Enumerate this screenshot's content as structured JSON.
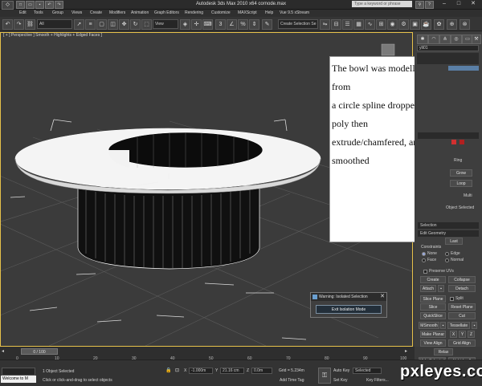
{
  "window": {
    "title": "Autodesk 3ds Max 2010 x64      cornode.max",
    "search_placeholder": "Type a keyword or phrase",
    "app_icon": "3ds-max-icon"
  },
  "menu": [
    "Edit",
    "Tools",
    "Group",
    "Views",
    "Create",
    "Modifiers",
    "Animation",
    "Graph Editors",
    "Rendering",
    "Customize",
    "MAXScript",
    "Help",
    "Vue 9.5 xStream"
  ],
  "toolbar": {
    "selection_filter": "All",
    "reference_coord": "View",
    "named_selection": "Create Selection Se"
  },
  "viewport": {
    "label": "[ + ] Perspective ] Smooth + Highlights + Edged Faces ]"
  },
  "command_panel": {
    "object_name": "ylt01",
    "rollouts": [
      "Selection",
      "Edit Geometry"
    ],
    "labels": {
      "ring": "Ring",
      "loop": "Loop",
      "grow": "Grow",
      "object_selected": "Object Selected",
      "last": "Last",
      "constraints": "Constraints",
      "none": "None",
      "edge": "Edge",
      "face": "Face",
      "normal": "Normal",
      "preserve_uvs": "Preserve UVs",
      "create": "Create",
      "collapse": "Collapse",
      "attach": "Attach",
      "detach": "Detach",
      "slice_plane": "Slice Plane",
      "split": "Split",
      "slice": "Slice",
      "reset_plane": "Reset Plane",
      "quickslice": "QuickSlice",
      "cut": "Cut",
      "msmooth": "MSmooth",
      "tessellate": "Tessellate",
      "make_planar": "Make Planar",
      "x": "X",
      "y": "Y",
      "z": "Z",
      "view_align": "View Align",
      "grid_align": "Grid Align",
      "relax": "Relax",
      "hide_selected": "Hide Selected",
      "unhide_all": "Unhide all",
      "multi": "Multi"
    }
  },
  "overlay_note": {
    "lines": [
      "The bowl was modelled from",
      "a circle spline dropped to a",
      "poly then",
      "extrude/chamfered, and",
      "smoothed"
    ]
  },
  "isolate_dialog": {
    "title": "Warning: Isolated Selection",
    "button": "Exit Isolation Mode"
  },
  "timeline": {
    "slider": "0 / 100",
    "ticks": [
      "0",
      "10",
      "20",
      "30",
      "40",
      "50",
      "60",
      "70",
      "80",
      "90",
      "100"
    ]
  },
  "status": {
    "welcome": "Welcome to M",
    "selected": "1 Object Selected",
    "prompt": "Click or click-and-drag to select objects",
    "x": "-1.000m",
    "y": "21.16 cm",
    "z": "0.0m",
    "grid": "Grid = 5.234m",
    "auto_key": "Auto Key",
    "selected_dd": "Selected",
    "set_key": "Set Key",
    "key_filters": "Key Filters...",
    "add_time_tag": "Add Time Tag"
  },
  "watermark": "pxleyes.com"
}
